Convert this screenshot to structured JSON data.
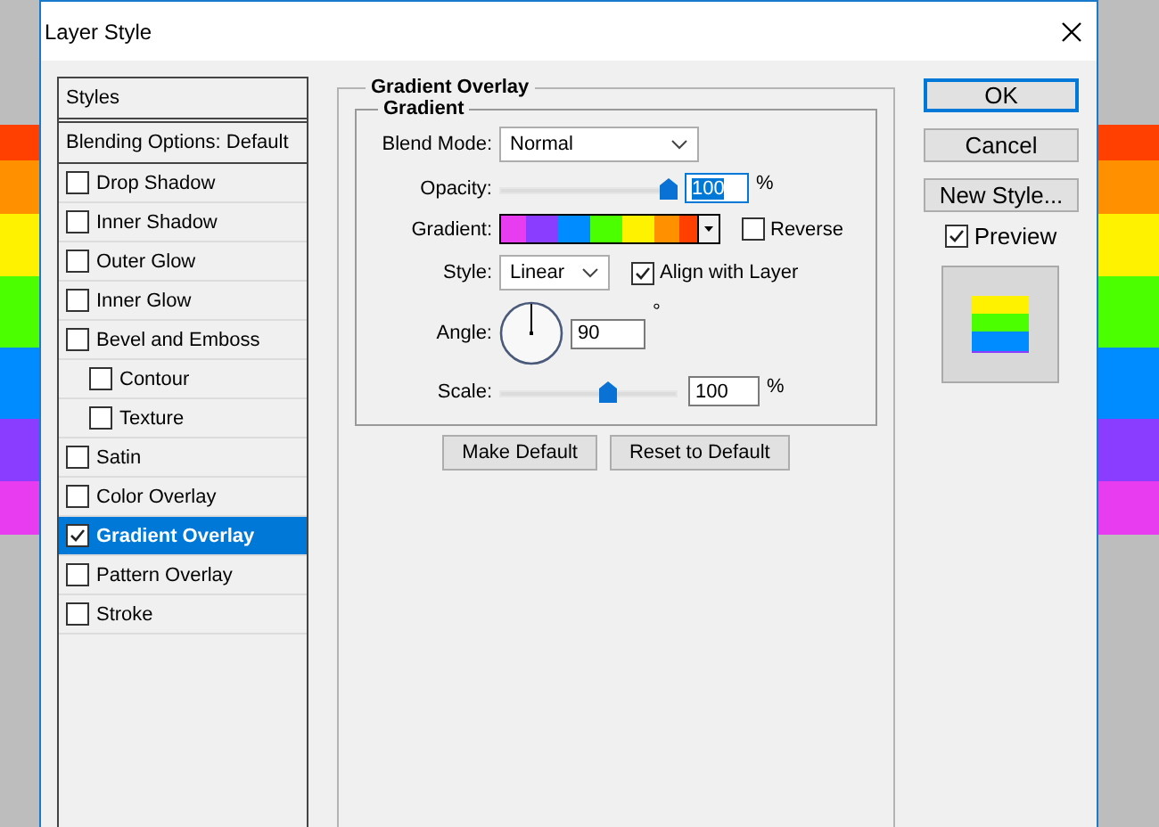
{
  "window": {
    "title": "Layer Style"
  },
  "styles_panel": {
    "header": "Styles",
    "blending": "Blending Options: Default",
    "items": [
      {
        "label": "Drop Shadow",
        "checked": false,
        "selected": false
      },
      {
        "label": "Inner Shadow",
        "checked": false,
        "selected": false
      },
      {
        "label": "Outer Glow",
        "checked": false,
        "selected": false
      },
      {
        "label": "Inner Glow",
        "checked": false,
        "selected": false
      },
      {
        "label": "Bevel and Emboss",
        "checked": false,
        "selected": false,
        "children": [
          {
            "label": "Contour",
            "checked": false,
            "selected": false
          },
          {
            "label": "Texture",
            "checked": false,
            "selected": false
          }
        ]
      },
      {
        "label": "Satin",
        "checked": false,
        "selected": false
      },
      {
        "label": "Color Overlay",
        "checked": false,
        "selected": false
      },
      {
        "label": "Gradient Overlay",
        "checked": true,
        "selected": true
      },
      {
        "label": "Pattern Overlay",
        "checked": false,
        "selected": false
      },
      {
        "label": "Stroke",
        "checked": false,
        "selected": false
      }
    ]
  },
  "gradient_overlay": {
    "title": "Gradient Overlay",
    "group_title": "Gradient",
    "blend_mode": {
      "label": "Blend Mode:",
      "value": "Normal"
    },
    "opacity": {
      "label": "Opacity:",
      "level": 1.0,
      "value": "100",
      "unit": "%"
    },
    "gradient": {
      "label": "Gradient:"
    },
    "reverse": {
      "label": "Reverse",
      "checked": false
    },
    "style": {
      "label": "Style:",
      "value": "Linear"
    },
    "align_with_layer": {
      "label": "Align with Layer",
      "checked": true
    },
    "angle": {
      "label": "Angle:",
      "value": "90",
      "unit": "°"
    },
    "scale": {
      "label": "Scale:",
      "level": 0.62,
      "value": "100",
      "unit": "%"
    },
    "buttons": [
      "Make Default",
      "Reset to Default"
    ]
  },
  "actions": [
    {
      "label": "OK",
      "primary": true
    },
    {
      "label": "Cancel",
      "primary": false
    },
    {
      "label": "New Style...",
      "primary": false
    }
  ],
  "preview": {
    "label": "Preview",
    "checked": true
  }
}
